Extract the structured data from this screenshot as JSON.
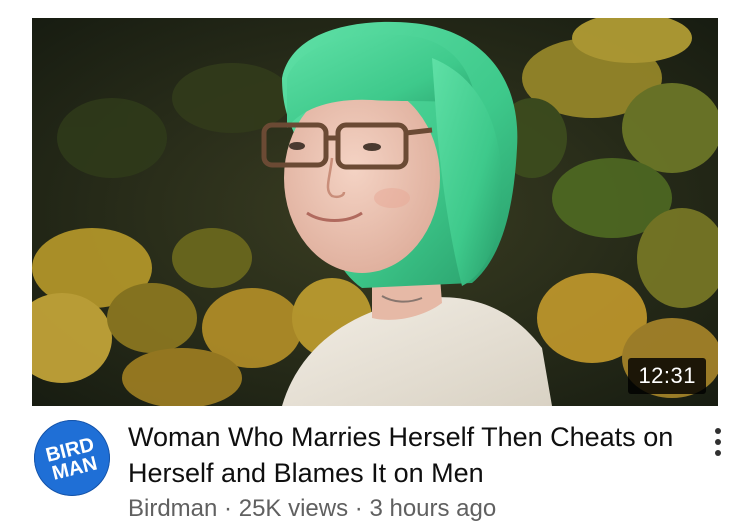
{
  "video": {
    "duration": "12:31",
    "title": "Woman Who Marries Herself Then Cheats on Herself and Blames It on Men",
    "channel_name": "Birdman",
    "views": "25K views",
    "uploaded": "3 hours ago",
    "separator": "·"
  },
  "avatar": {
    "logo_line1": "BIRD",
    "logo_line2": "MAN",
    "background_color": "#1f6fd6",
    "text_color": "#ffffff"
  },
  "menu": {
    "icon": "more-vert-icon"
  },
  "colors": {
    "title_text": "#0f0f0f",
    "meta_text": "#606060",
    "duration_bg": "#000000",
    "hair": "#3ec98b"
  }
}
